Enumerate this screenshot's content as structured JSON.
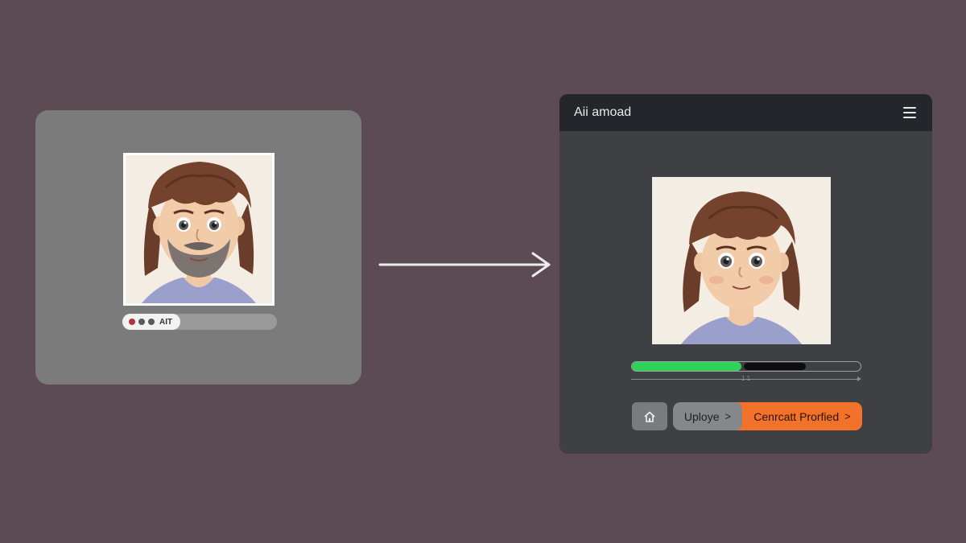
{
  "left_card": {
    "status_pill": {
      "label": "AIT",
      "dots": [
        "#b43245",
        "#5a5a5a",
        "#5a5a5a"
      ]
    }
  },
  "window": {
    "title": "Aii amoad",
    "menu_icon": "hamburger-menu-icon",
    "progress": {
      "fill_percent": 48,
      "scale_mark": "1 1"
    },
    "buttons": {
      "home_icon": "home-icon",
      "upload_label": "Uploye",
      "convert_label": "Cenrcatt Prorfied",
      "chevron": ">"
    }
  },
  "colors": {
    "background": "#5c4b52",
    "left_card": "#7b7b7b",
    "window": "#3f4043",
    "titlebar": "#24262b",
    "progress_fill": "#2fd35a",
    "accent_orange": "#f2722b"
  }
}
